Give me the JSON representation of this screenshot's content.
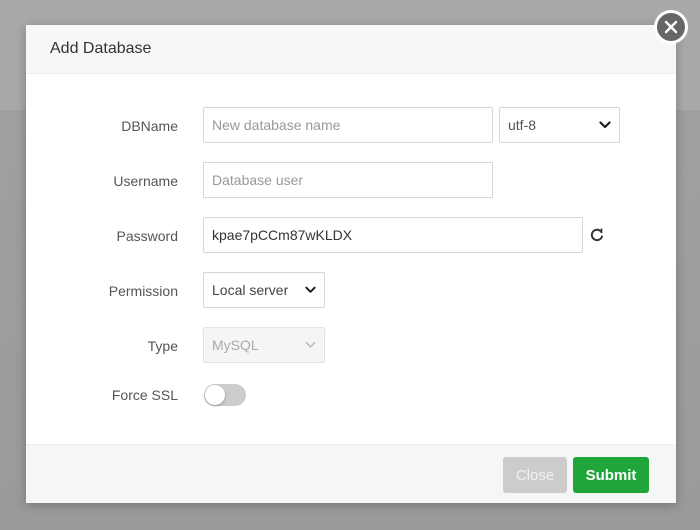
{
  "modal": {
    "title": "Add Database",
    "close_icon": "close-x-icon"
  },
  "form": {
    "dbname": {
      "label": "DBName",
      "value": "",
      "placeholder": "New database name",
      "charset": {
        "selected": "utf-8",
        "icon": "chevron-down-icon"
      }
    },
    "username": {
      "label": "Username",
      "value": "",
      "placeholder": "Database user"
    },
    "password": {
      "label": "Password",
      "value": "kpae7pCCm87wKLDX",
      "refresh_icon": "refresh-icon"
    },
    "permission": {
      "label": "Permission",
      "selected": "Local server"
    },
    "type": {
      "label": "Type",
      "selected": "MySQL",
      "disabled": true
    },
    "force_ssl": {
      "label": "Force SSL",
      "enabled": false
    }
  },
  "footer": {
    "close_label": "Close",
    "submit_label": "Submit"
  },
  "colors": {
    "submit": "#20a53a",
    "close_button": "#cccccc",
    "close_x": "#666666"
  }
}
